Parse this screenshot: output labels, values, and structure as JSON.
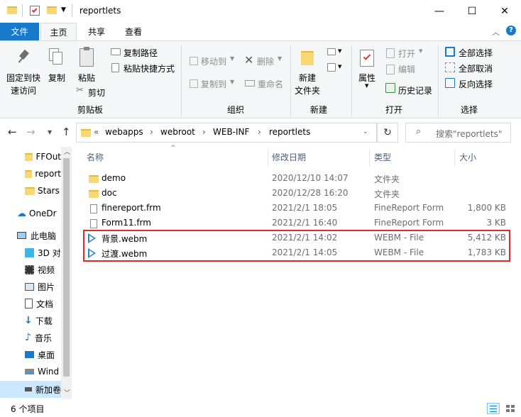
{
  "window": {
    "title": "reportlets",
    "minimize": "—",
    "maximize": "☐",
    "close": "✕"
  },
  "tabs": [
    {
      "label": "文件"
    },
    {
      "label": "主页"
    },
    {
      "label": "共享"
    },
    {
      "label": "查看"
    }
  ],
  "ribbon": {
    "pin_label_1": "固定到快",
    "pin_label_2": "速访问",
    "copy": "复制",
    "paste": "粘贴",
    "copy_path": "复制路径",
    "paste_shortcut": "粘贴快捷方式",
    "cut": "剪切",
    "group_clipboard": "剪贴板",
    "move_to": "移动到",
    "copy_to": "复制到",
    "delete": "删除",
    "rename": "重命名",
    "group_organize": "组织",
    "new_folder_1": "新建",
    "new_folder_2": "文件夹",
    "group_new": "新建",
    "properties": "属性",
    "open": "打开",
    "edit": "编辑",
    "history": "历史记录",
    "group_open": "打开",
    "select_all": "全部选择",
    "select_none": "全部取消",
    "invert_selection": "反向选择",
    "group_select": "选择"
  },
  "address": {
    "breadcrumbs": [
      "«",
      "webapps",
      "webroot",
      "WEB-INF",
      "reportlets"
    ],
    "search_placeholder": "搜索\"reportlets\""
  },
  "sidebar": {
    "items": [
      {
        "label": "FFOut"
      },
      {
        "label": "report"
      },
      {
        "label": "Stars"
      },
      {
        "label": "OneDr"
      },
      {
        "label": "此电脑"
      },
      {
        "label": "3D 对"
      },
      {
        "label": "视频"
      },
      {
        "label": "图片"
      },
      {
        "label": "文档"
      },
      {
        "label": "下载"
      },
      {
        "label": "音乐"
      },
      {
        "label": "桌面"
      },
      {
        "label": "Wind"
      },
      {
        "label": "新加卷"
      }
    ]
  },
  "columns": {
    "name": "名称",
    "date": "修改日期",
    "type": "类型",
    "size": "大小"
  },
  "files": [
    {
      "name": "demo",
      "date": "2020/12/10 14:07",
      "type": "文件夹",
      "size": ""
    },
    {
      "name": "doc",
      "date": "2020/12/28 16:20",
      "type": "文件夹",
      "size": ""
    },
    {
      "name": "finereport.frm",
      "date": "2021/2/1 18:05",
      "type": "FineReport Form",
      "size": "1,800 KB"
    },
    {
      "name": "Form11.frm",
      "date": "2021/2/1 16:40",
      "type": "FineReport Form",
      "size": "3 KB"
    },
    {
      "name": "背景.webm",
      "date": "2021/2/1 14:02",
      "type": "WEBM - File",
      "size": "5,412 KB"
    },
    {
      "name": "过渡.webm",
      "date": "2021/2/1 14:05",
      "type": "WEBM - File",
      "size": "1,783 KB"
    }
  ],
  "status": {
    "count": "6 个项目"
  },
  "colors": {
    "accent": "#1979ca",
    "highlight_border": "#e02a2a"
  }
}
